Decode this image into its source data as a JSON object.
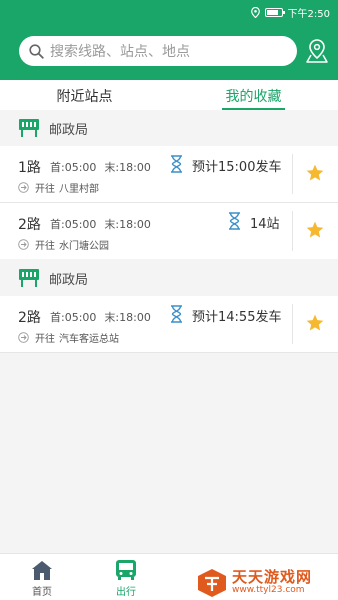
{
  "status": {
    "time": "下午2:50"
  },
  "search": {
    "placeholder": "搜索线路、站点、地点"
  },
  "tabs": [
    {
      "label": "附近站点",
      "active": false
    },
    {
      "label": "我的收藏",
      "active": true
    }
  ],
  "groups": [
    {
      "stop": "邮政局",
      "routes": [
        {
          "number": "1路",
          "first": "首:05:00",
          "last": "末:18:00",
          "eta": "预计15:00发车",
          "direction_prefix": "开往",
          "direction": "八里村部"
        },
        {
          "number": "2路",
          "first": "首:05:00",
          "last": "末:18:00",
          "eta": "14站",
          "direction_prefix": "开往",
          "direction": "水门塘公园"
        }
      ]
    },
    {
      "stop": "邮政局",
      "routes": [
        {
          "number": "2路",
          "first": "首:05:00",
          "last": "末:18:00",
          "eta": "预计14:55发车",
          "direction_prefix": "开往",
          "direction": "汽车客运总站"
        }
      ]
    }
  ],
  "tabbar": {
    "home": "首页",
    "travel": "出行"
  },
  "watermark": {
    "title": "天天游戏网",
    "url": "www.ttyl23.com"
  },
  "colors": {
    "brand": "#1aa569",
    "star": "#f5b82e",
    "hourglass": "#3b8fc9"
  },
  "icons": [
    "location-icon",
    "battery-icon",
    "search-icon",
    "map-pin-icon",
    "bus-stop-icon",
    "hourglass-icon",
    "arrow-right-circle-icon",
    "star-icon",
    "home-icon",
    "bus-icon"
  ]
}
